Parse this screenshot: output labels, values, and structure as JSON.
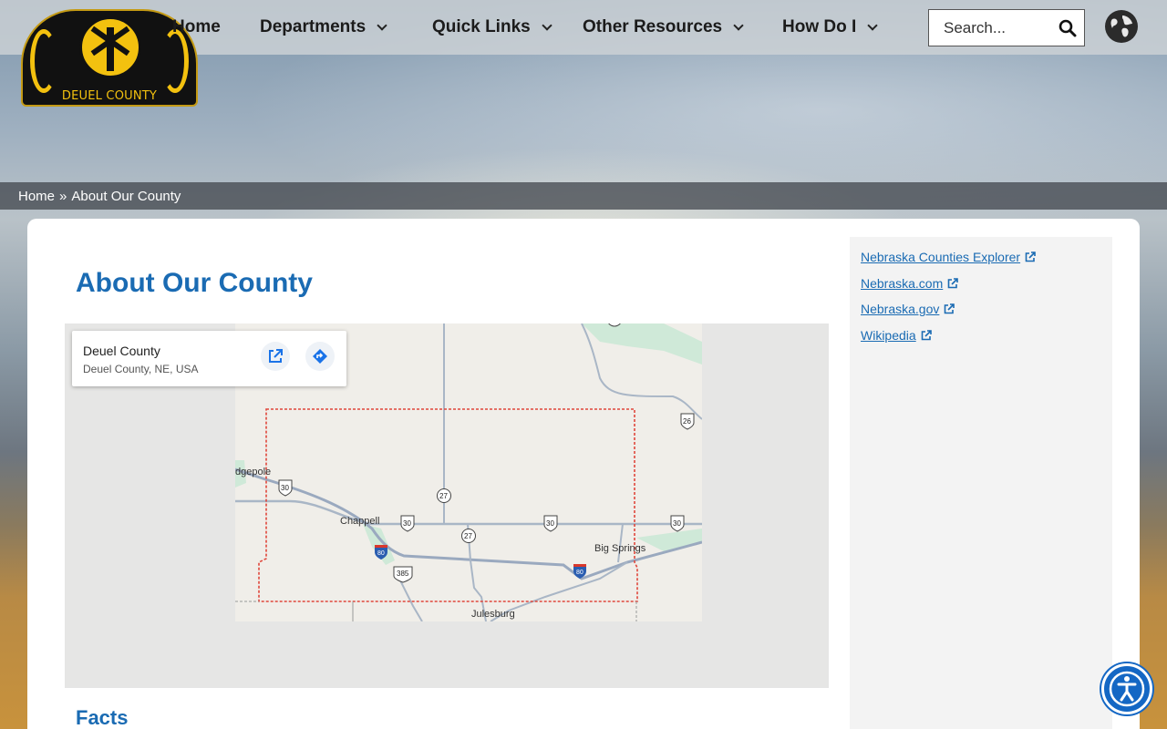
{
  "header": {
    "logo_text": "DEUEL COUNTY",
    "nav": [
      {
        "label": "Home",
        "has_dropdown": false
      },
      {
        "label": "Departments",
        "has_dropdown": true
      },
      {
        "label": "Quick Links",
        "has_dropdown": true
      },
      {
        "label": "Other Resources",
        "has_dropdown": true
      },
      {
        "label": "How Do I",
        "has_dropdown": true
      }
    ],
    "search": {
      "placeholder": "Search...",
      "icon": "search-icon"
    },
    "translate_icon": "globe-icon"
  },
  "breadcrumb": {
    "home": "Home",
    "separator": "»",
    "current": "About Our County"
  },
  "main": {
    "title": "About Our County",
    "map": {
      "place_name": "Deuel County",
      "place_address": "Deuel County, NE, USA",
      "labels": {
        "lodgepole": "dgepole",
        "chappell": "Chappell",
        "big_springs": "Big Springs",
        "julesburg": "Julesburg"
      },
      "shields": {
        "us30": "30",
        "ne27": "27",
        "us26": "26",
        "us385": "385",
        "i80": "80"
      }
    },
    "section_heading": "Facts"
  },
  "sidebar": {
    "links": [
      {
        "label": "Nebraska Counties Explorer"
      },
      {
        "label": "Nebraska.com"
      },
      {
        "label": "Nebraska.gov"
      },
      {
        "label": "Wikipedia"
      }
    ]
  },
  "colors": {
    "accent": "#1a6bb3",
    "logo_gold": "#f3c10f",
    "accessibility_button": "#1467c4"
  }
}
